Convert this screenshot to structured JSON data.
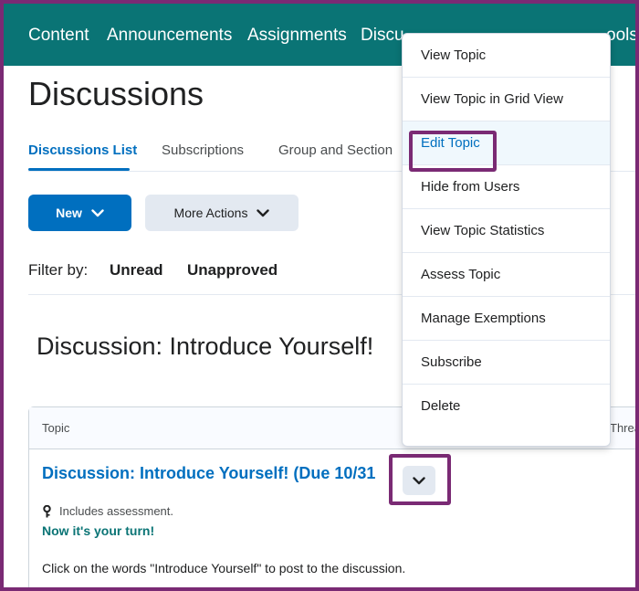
{
  "navbar": {
    "items": [
      "Content",
      "Announcements",
      "Assignments",
      "Discu",
      "ools"
    ]
  },
  "page": {
    "title": "Discussions"
  },
  "tabs": {
    "items": [
      "Discussions List",
      "Subscriptions",
      "Group and Section"
    ]
  },
  "actions": {
    "new_label": "New",
    "more_label": "More Actions"
  },
  "filter": {
    "label": "Filter by:",
    "options": [
      "Unread",
      "Unapproved"
    ]
  },
  "forum": {
    "heading": "Discussion: Introduce Yourself!"
  },
  "table": {
    "headers": [
      "Topic",
      "Threa"
    ],
    "row": {
      "title": "Discussion: Introduce Yourself! (Due 10/31",
      "assessment_note": "Includes assessment.",
      "turn_text": "Now it's your turn!",
      "instructions": "Click on the words \"Introduce Yourself\" to post to the discussion."
    }
  },
  "context_menu": {
    "items": [
      "View Topic",
      "View Topic in Grid View",
      "Edit Topic",
      "Hide from Users",
      "View Topic Statistics",
      "Assess Topic",
      "Manage Exemptions",
      "Subscribe",
      "Delete"
    ]
  },
  "colors": {
    "nav_bg": "#0a7475",
    "primary": "#006fbf",
    "highlight": "#7a2a74"
  }
}
